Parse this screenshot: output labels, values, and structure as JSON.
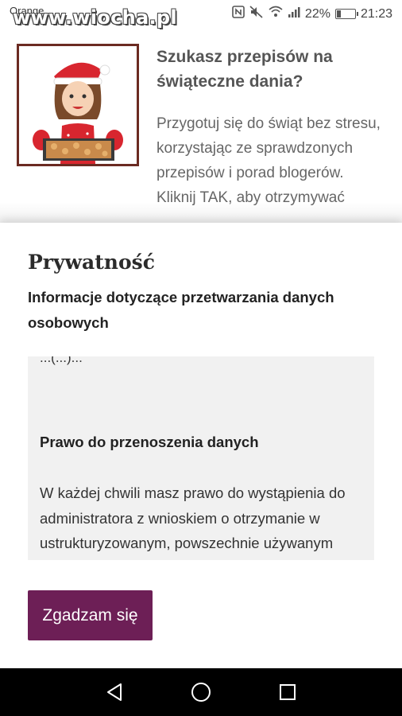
{
  "status_bar": {
    "carrier": "Orange",
    "watermark": "www.wiocha.pl",
    "battery_percent": "22%",
    "battery_level": 0.22,
    "time": "21:23",
    "icons": [
      "nfc-icon",
      "mute-icon",
      "wifi-icon",
      "signal-icon",
      "battery-icon"
    ]
  },
  "article": {
    "title": "Szukasz przepisów na świąteczne dania?",
    "text": "Przygotuj się do świąt bez stresu, korzystając ze sprawdzonych przepisów i porad blogerów.",
    "text_cutoff": "Kliknij TAK, aby otrzymywać"
  },
  "modal": {
    "title": "Prywatność",
    "subtitle": "Informacje dotyczące przetwarzania danych osobowych",
    "cutoff_line": "...(...)...",
    "section_heading": "Prawo do przenoszenia danych",
    "section_body": "W każdej chwili masz prawo do wystąpienia do administratora z wnioskiem o otrzymanie w ustrukturyzowanym, powszechnie używanym formacie nadającym się do odczytu",
    "agree_button": "Zgadzam się",
    "accent_color": "#6d1f56"
  },
  "nav_bar": {
    "icons": [
      "back-icon",
      "home-icon",
      "recents-icon"
    ]
  }
}
